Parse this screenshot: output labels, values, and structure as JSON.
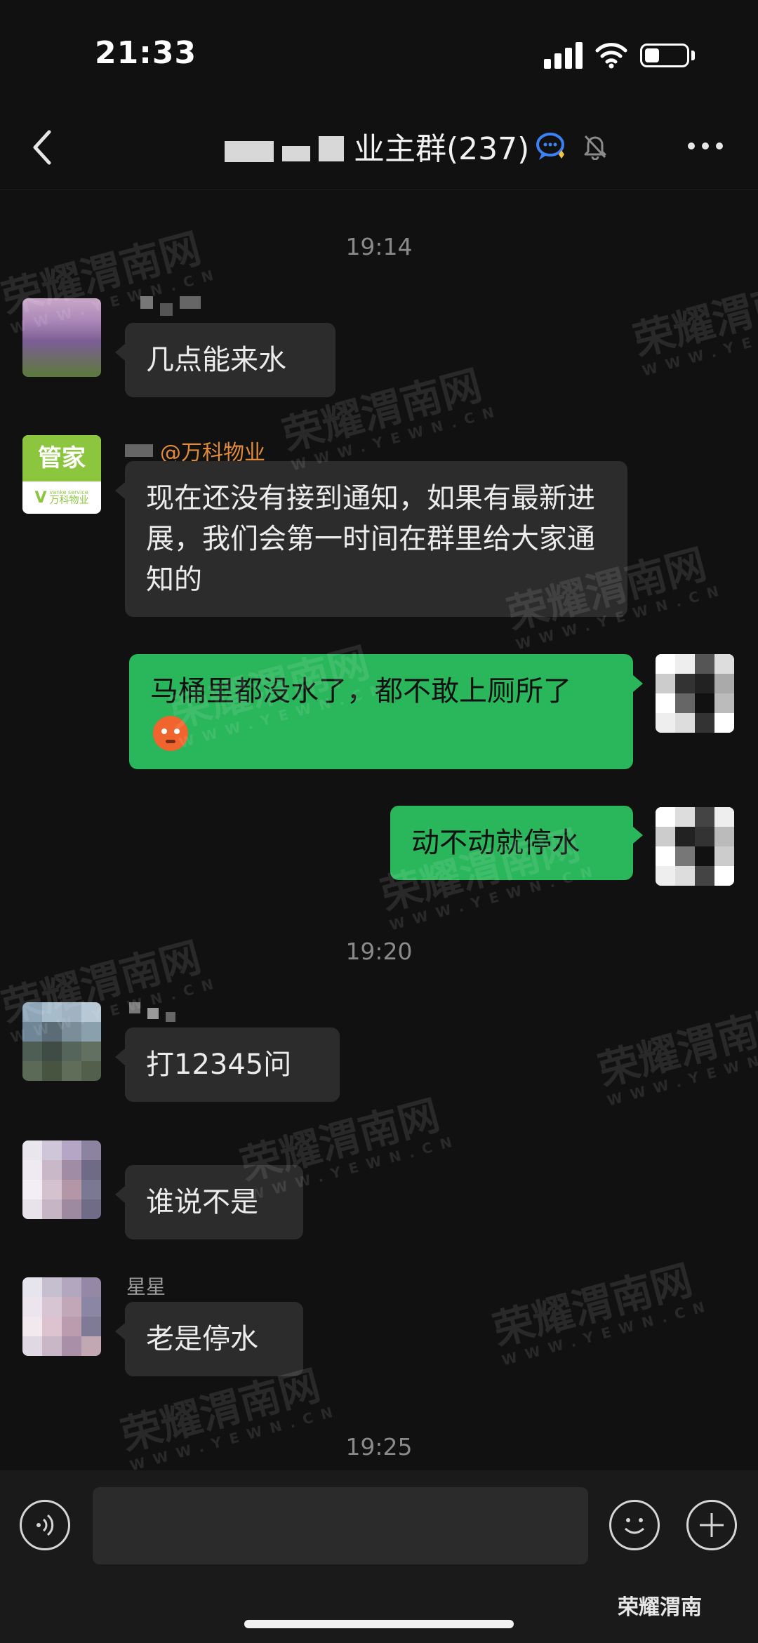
{
  "status_bar": {
    "time": "21:33"
  },
  "nav": {
    "title_suffix": "业主群(237)"
  },
  "timestamps": [
    "19:14",
    "19:20",
    "19:25"
  ],
  "messages": [
    {
      "side": "in",
      "sender": "",
      "text": "几点能来水"
    },
    {
      "side": "in",
      "sender_tag": "@万科物业",
      "avatar_text": "管家",
      "avatar_sub": "万科物业",
      "avatar_en": "vanke service",
      "text": "现在还没有接到通知，如果有最新进展，我们会第一时间在群里给大家通知的"
    },
    {
      "side": "out",
      "text": "马桶里都没水了，都不敢上厕所了"
    },
    {
      "side": "out",
      "text": "动不动就停水"
    },
    {
      "side": "in",
      "sender": "",
      "text": "打12345问"
    },
    {
      "side": "in",
      "sender": "",
      "text": "谁说不是"
    },
    {
      "side": "in",
      "sender": "星星",
      "text": "老是停水"
    }
  ],
  "watermark": {
    "main": "荣耀渭南网",
    "sub": "WWW.YEWN.CN"
  },
  "brand": {
    "name": "荣耀渭南"
  },
  "colors": {
    "background": "#111111",
    "incoming_bubble": "#2c2c2c",
    "outgoing_bubble": "#2ab65b",
    "mention": "#e08a3a"
  }
}
